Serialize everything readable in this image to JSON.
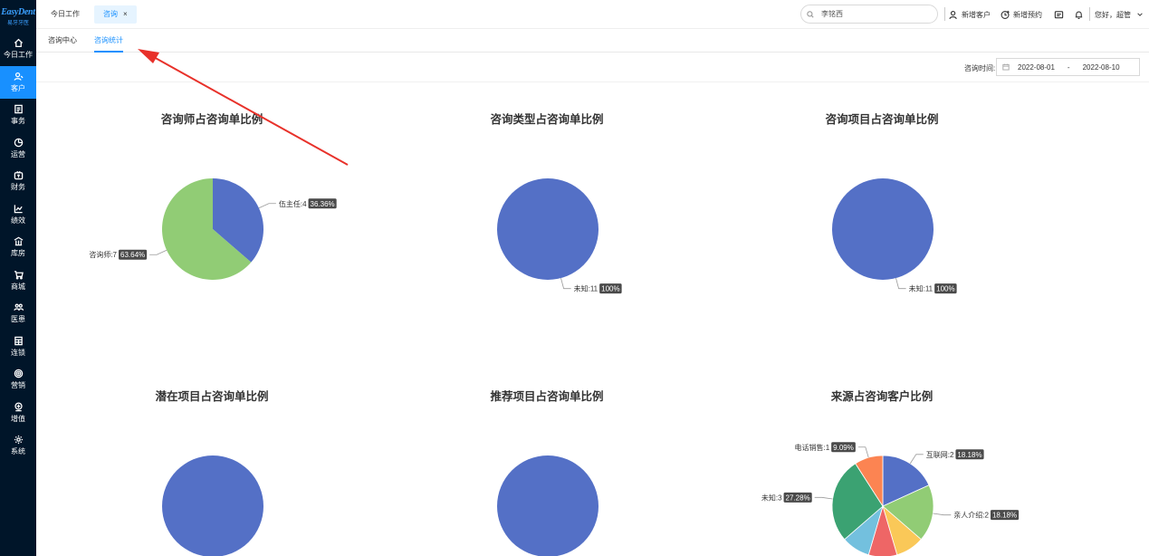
{
  "app": {
    "logo": "EasyDent",
    "logo_sub": "易牙牙医"
  },
  "sidebar": {
    "items": [
      {
        "label": "今日工作",
        "icon": "home-icon"
      },
      {
        "label": "客户",
        "icon": "user-icon",
        "active": true
      },
      {
        "label": "事务",
        "icon": "task-icon"
      },
      {
        "label": "运营",
        "icon": "operation-icon"
      },
      {
        "label": "财务",
        "icon": "finance-icon"
      },
      {
        "label": "绩效",
        "icon": "performance-icon"
      },
      {
        "label": "库房",
        "icon": "warehouse-icon"
      },
      {
        "label": "商城",
        "icon": "cart-icon"
      },
      {
        "label": "医患",
        "icon": "doctor-patient-icon"
      },
      {
        "label": "连锁",
        "icon": "chain-icon"
      },
      {
        "label": "营销",
        "icon": "marketing-icon"
      },
      {
        "label": "增值",
        "icon": "value-added-icon"
      },
      {
        "label": "系统",
        "icon": "settings-icon"
      }
    ]
  },
  "topbar": {
    "tabs": [
      {
        "label": "今日工作"
      },
      {
        "label": "咨询"
      }
    ],
    "close_glyph": "×",
    "search_value": "李铭西",
    "new_customer": "新增客户",
    "new_appointment": "新增预约",
    "greeting": "您好，超管"
  },
  "subtabs": [
    {
      "label": "咨询中心"
    },
    {
      "label": "咨询统计"
    }
  ],
  "filter": {
    "label": "咨询时间:",
    "date_start": "2022-08-01",
    "dash": "-",
    "date_end": "2022-08-10"
  },
  "colors": {
    "blue": "#5470c6",
    "green": "#91cc75",
    "yellow": "#fac858",
    "red": "#ee6666",
    "light_blue": "#73c0de",
    "teal": "#3ba272",
    "orange": "#fc8452",
    "primary": "#1890ff",
    "arrow": "#e8312a"
  },
  "chart_data": [
    {
      "type": "pie",
      "title": "咨询师占咨询单比例",
      "slices": [
        {
          "label": "伍主任:4",
          "value": 4,
          "percent": "36.36%",
          "color": "#5470c6"
        },
        {
          "label": "咨询师:7",
          "value": 7,
          "percent": "63.64%",
          "color": "#91cc75"
        }
      ]
    },
    {
      "type": "pie",
      "title": "咨询类型占咨询单比例",
      "slices": [
        {
          "label": "未知:11",
          "value": 11,
          "percent": "100%",
          "color": "#5470c6"
        }
      ]
    },
    {
      "type": "pie",
      "title": "咨询项目占咨询单比例",
      "slices": [
        {
          "label": "未知:11",
          "value": 11,
          "percent": "100%",
          "color": "#5470c6"
        }
      ]
    },
    {
      "type": "pie",
      "title": "潜在项目占咨询单比例",
      "slices": [
        {
          "label": "",
          "value": 11,
          "percent": "",
          "color": "#5470c6"
        }
      ]
    },
    {
      "type": "pie",
      "title": "推荐项目占咨询单比例",
      "slices": [
        {
          "label": "",
          "value": 11,
          "percent": "",
          "color": "#5470c6"
        }
      ]
    },
    {
      "type": "pie",
      "title": "来源占咨询客户比例",
      "slices": [
        {
          "label": "互联网:2",
          "value": 2,
          "percent": "18.18%",
          "color": "#5470c6"
        },
        {
          "label": "亲人介绍:2",
          "value": 2,
          "percent": "18.18%",
          "color": "#91cc75"
        },
        {
          "label": "",
          "value": 1,
          "percent": "",
          "color": "#fac858"
        },
        {
          "label": "",
          "value": 1,
          "percent": "",
          "color": "#ee6666"
        },
        {
          "label": "",
          "value": 1,
          "percent": "",
          "color": "#73c0de"
        },
        {
          "label": "未知:3",
          "value": 3,
          "percent": "27.28%",
          "color": "#3ba272"
        },
        {
          "label": "电话销售:1",
          "value": 1,
          "percent": "9.09%",
          "color": "#fc8452"
        }
      ]
    }
  ]
}
